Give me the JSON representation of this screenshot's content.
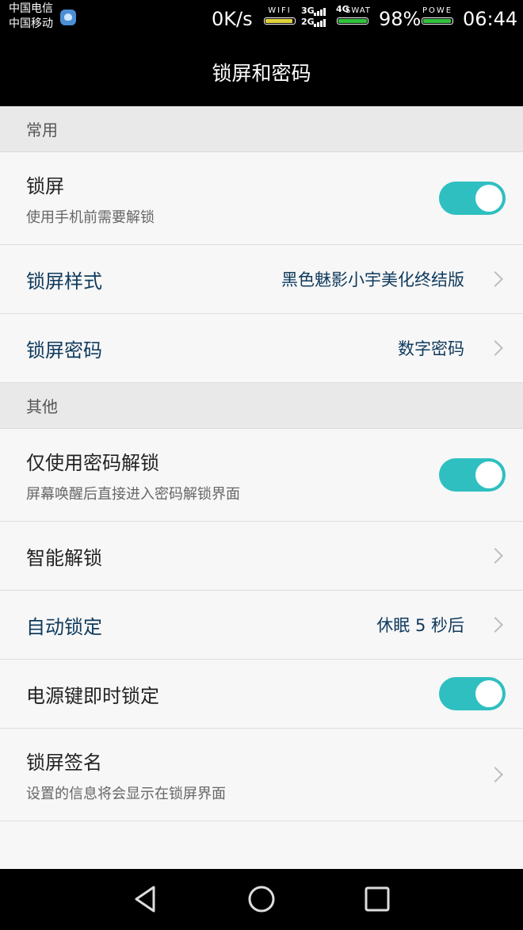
{
  "status_bar": {
    "carrier_1": "中国电信",
    "carrier_2": "中国移动",
    "net_speed": "0K/s",
    "wifi_label": "WIFI",
    "wifi_level": 0.95,
    "signal_label_top": "3G",
    "signal_label_bottom": "2G",
    "network_label": "4G",
    "swat_label": "SWAT",
    "swat_level": 1.0,
    "battery_percent": "98%",
    "power_label": "POWE",
    "power_level": 0.98,
    "time": "06:44",
    "colors": {
      "wifi": "#e0d23a",
      "green": "#2fc23c"
    }
  },
  "title": "锁屏和密码",
  "sections": [
    {
      "header": "常用",
      "rows": [
        {
          "title": "锁屏",
          "subtitle": "使用手机前需要解锁",
          "toggle": true
        },
        {
          "title": "锁屏样式",
          "value": "黑色魅影小宇美化终结版",
          "chevron": true
        },
        {
          "title": "锁屏密码",
          "value": "数字密码",
          "chevron": true
        }
      ]
    },
    {
      "header": "其他",
      "rows": [
        {
          "title": "仅使用密码解锁",
          "subtitle": "屏幕唤醒后直接进入密码解锁界面",
          "toggle": true
        },
        {
          "title": "智能解锁",
          "chevron": true
        },
        {
          "title": "自动锁定",
          "value": "休眠 5 秒后",
          "chevron": true
        },
        {
          "title": "电源键即时锁定",
          "toggle": true
        },
        {
          "title": "锁屏签名",
          "subtitle": "设置的信息将会显示在锁屏界面",
          "chevron": true
        }
      ]
    }
  ],
  "nav_bar": {
    "back": "back-triangle-icon",
    "home": "home-circle-icon",
    "recents": "recents-square-icon"
  },
  "accent_color": "#2fbfc0"
}
